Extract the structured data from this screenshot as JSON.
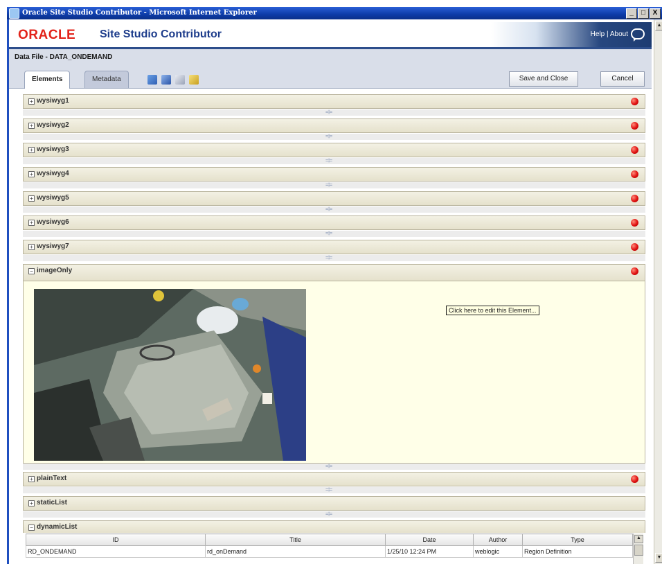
{
  "window": {
    "title": "Oracle Site Studio Contributor - Microsoft Internet Explorer",
    "buttons": [
      "_",
      "□",
      "X"
    ]
  },
  "header": {
    "logo": "ORACLE",
    "product": "Site Studio Contributor",
    "help": "Help",
    "separator": " | ",
    "about": "About"
  },
  "datafile": {
    "title": "Data File - DATA_ONDEMAND",
    "tabs": [
      "Elements",
      "Metadata"
    ],
    "save_label": "Save and Close",
    "cancel_label": "Cancel"
  },
  "elements": [
    {
      "label": "wysiwyg1",
      "expanded": false,
      "required": true
    },
    {
      "label": "wysiwyg2",
      "expanded": false,
      "required": true
    },
    {
      "label": "wysiwyg3",
      "expanded": false,
      "required": true
    },
    {
      "label": "wysiwyg4",
      "expanded": false,
      "required": true
    },
    {
      "label": "wysiwyg5",
      "expanded": false,
      "required": true
    },
    {
      "label": "wysiwyg6",
      "expanded": false,
      "required": true
    },
    {
      "label": "wysiwyg7",
      "expanded": false,
      "required": true
    },
    {
      "label": "imageOnly",
      "expanded": true,
      "required": true
    },
    {
      "label": "plainText",
      "expanded": false,
      "required": true
    },
    {
      "label": "staticList",
      "expanded": false,
      "required": false
    },
    {
      "label": "dynamicList",
      "expanded": true,
      "required": false
    }
  ],
  "image_element": {
    "edit_hint": "Click here to edit this Element..."
  },
  "dynamic_list": {
    "columns": [
      "ID",
      "Title",
      "Date",
      "Author",
      "Type"
    ],
    "rows": [
      [
        "RD_ONDEMAND",
        "rd_onDemand",
        "1/25/10 12:24 PM",
        "weblogic",
        "Region Definition"
      ]
    ]
  },
  "colors": {
    "oracle_red": "#e2231a",
    "product_blue": "#1d3c8b",
    "required_dot": "#e01010",
    "panel_bg": "#ffffe8"
  }
}
